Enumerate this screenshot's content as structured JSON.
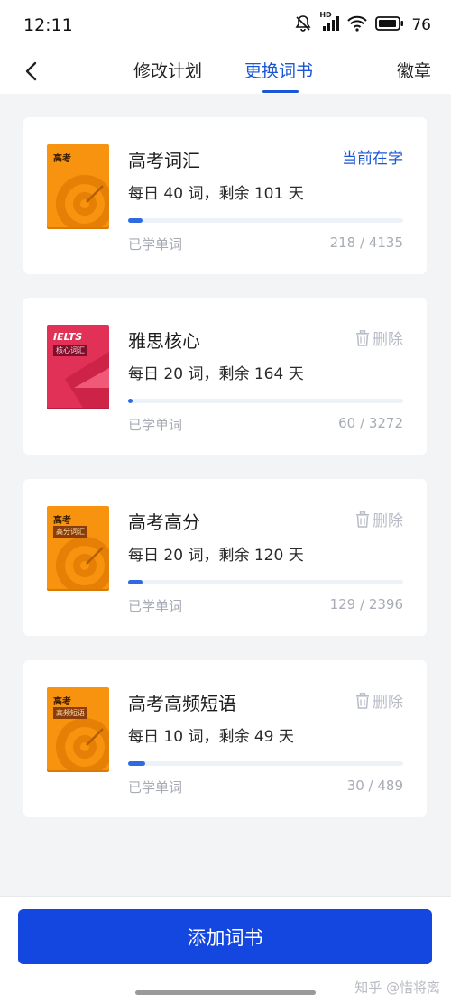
{
  "status_bar": {
    "time": "12:11",
    "battery": "76",
    "hd_label": "HD"
  },
  "nav": {
    "tabs": [
      {
        "label": "修改计划",
        "active": false
      },
      {
        "label": "更换词书",
        "active": true
      },
      {
        "label": "徽章",
        "active": false
      }
    ]
  },
  "books": [
    {
      "title": "高考词汇",
      "cover_title": "高考",
      "cover_tag": "",
      "plan": "每日 40 词，剩余 101 天",
      "status": "当前在学",
      "learned_label": "已学单词",
      "learned_count": "218 / 4135",
      "progress": 0.053,
      "cover_color": "#f7930f"
    },
    {
      "title": "雅思核心",
      "cover_title": "IELTS",
      "cover_tag": "核心词汇",
      "plan": "每日 20 词，剩余 164 天",
      "action": "删除",
      "learned_label": "已学单词",
      "learned_count": "60 / 3272",
      "progress": 0.018,
      "cover_color": "#e23157"
    },
    {
      "title": "高考高分",
      "cover_title": "高考",
      "cover_tag": "高分词汇",
      "plan": "每日 20 词，剩余 120 天",
      "action": "删除",
      "learned_label": "已学单词",
      "learned_count": "129 / 2396",
      "progress": 0.054,
      "cover_color": "#f7930f"
    },
    {
      "title": "高考高频短语",
      "cover_title": "高考",
      "cover_tag": "高频短语",
      "plan": "每日 10 词，剩余 49 天",
      "action": "删除",
      "learned_label": "已学单词",
      "learned_count": "30 / 489",
      "progress": 0.061,
      "cover_color": "#f7930f"
    }
  ],
  "footer": {
    "add_button": "添加词书",
    "watermark": "知乎 @惜将离"
  },
  "colors": {
    "accent": "#1a56d6",
    "button": "#1447e0",
    "muted": "#a7abb5"
  }
}
